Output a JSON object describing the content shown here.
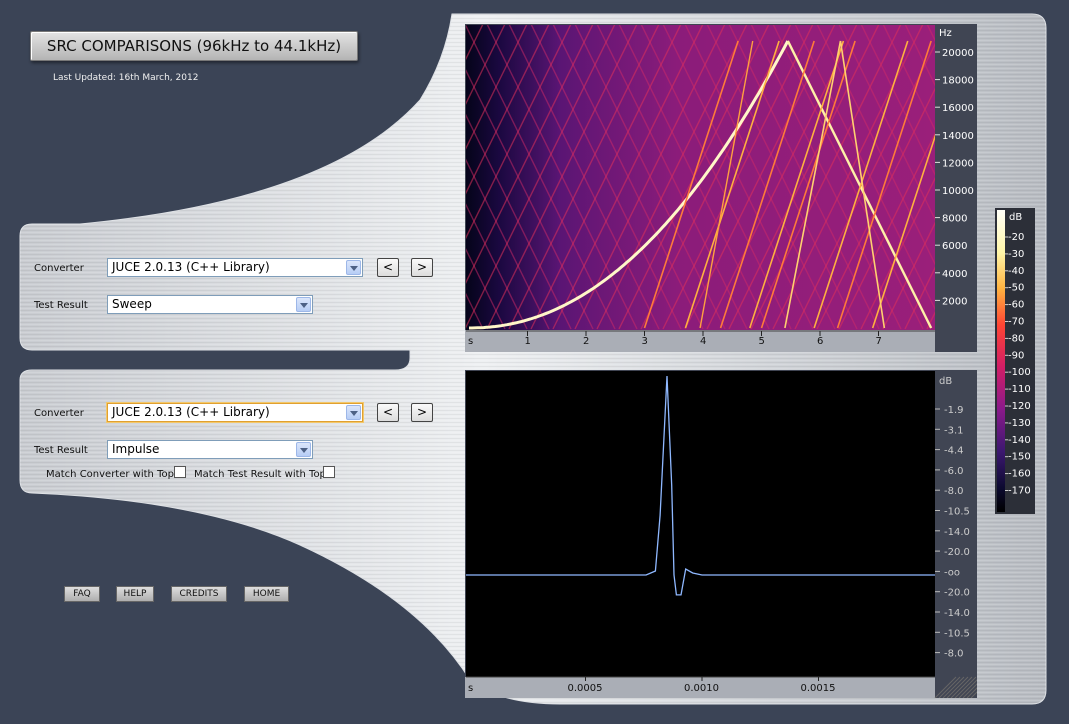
{
  "header": {
    "title": "SRC COMPARISONS (96kHz to 44.1kHz)",
    "last_updated": "Last Updated: 16th March, 2012"
  },
  "top_panel": {
    "converter_label": "Converter",
    "converter_value": "JUCE 2.0.13 (C++ Library)",
    "test_result_label": "Test Result",
    "test_result_value": "Sweep",
    "prev_label": "<",
    "next_label": ">"
  },
  "bottom_panel": {
    "converter_label": "Converter",
    "converter_value": "JUCE 2.0.13 (C++ Library)",
    "test_result_label": "Test Result",
    "test_result_value": "Impulse",
    "prev_label": "<",
    "next_label": ">",
    "match_converter_label": "Match Converter with Top",
    "match_test_label": "Match Test Result with Top"
  },
  "footer_links": [
    "FAQ",
    "HELP",
    "CREDITS",
    "HOME"
  ],
  "spectrogram": {
    "freq_unit": "Hz",
    "freq_ticks": [
      "20000",
      "18000",
      "16000",
      "14000",
      "12000",
      "10000",
      "8000",
      "6000",
      "4000",
      "2000"
    ],
    "time_unit": "s",
    "time_ticks": [
      "1",
      "2",
      "3",
      "4",
      "5",
      "6",
      "7"
    ]
  },
  "color_scale": {
    "unit": "dB",
    "ticks": [
      "-20",
      "-30",
      "-40",
      "-50",
      "-60",
      "-70",
      "-80",
      "-90",
      "-100",
      "-110",
      "-120",
      "-130",
      "-140",
      "-150",
      "-160",
      "-170"
    ]
  },
  "chart_data": {
    "type": "line",
    "title": "",
    "xlabel": "s",
    "ylabel": "dB",
    "x_ticks": [
      "0.0005",
      "0.0010",
      "0.0015"
    ],
    "y_ticks": [
      "-1.9",
      "-3.1",
      "-4.4",
      "-6.0",
      "-8.0",
      "-10.5",
      "-14.0",
      "-20.0",
      "-oo",
      "-20.0",
      "-14.0",
      "-10.5",
      "-8.0"
    ],
    "series": [
      {
        "color": "#8fb8ff",
        "x": [
          0.0,
          0.00076,
          0.0008,
          0.00082,
          0.00085,
          0.00087,
          0.00088,
          0.00089,
          0.00091,
          0.00093,
          0.00096,
          0.001,
          0.0018
        ],
        "y_fraction": [
          0.0,
          0.0,
          0.02,
          0.3,
          1.0,
          0.45,
          0.0,
          -0.1,
          -0.1,
          0.03,
          0.01,
          0.0,
          0.0
        ]
      }
    ]
  },
  "colors": {
    "background": "#3b4456",
    "impulse_line": "#8fb8ff",
    "spectrogram_bright": "#fff6c8",
    "spectrogram_mid": "#ff4d3a"
  }
}
